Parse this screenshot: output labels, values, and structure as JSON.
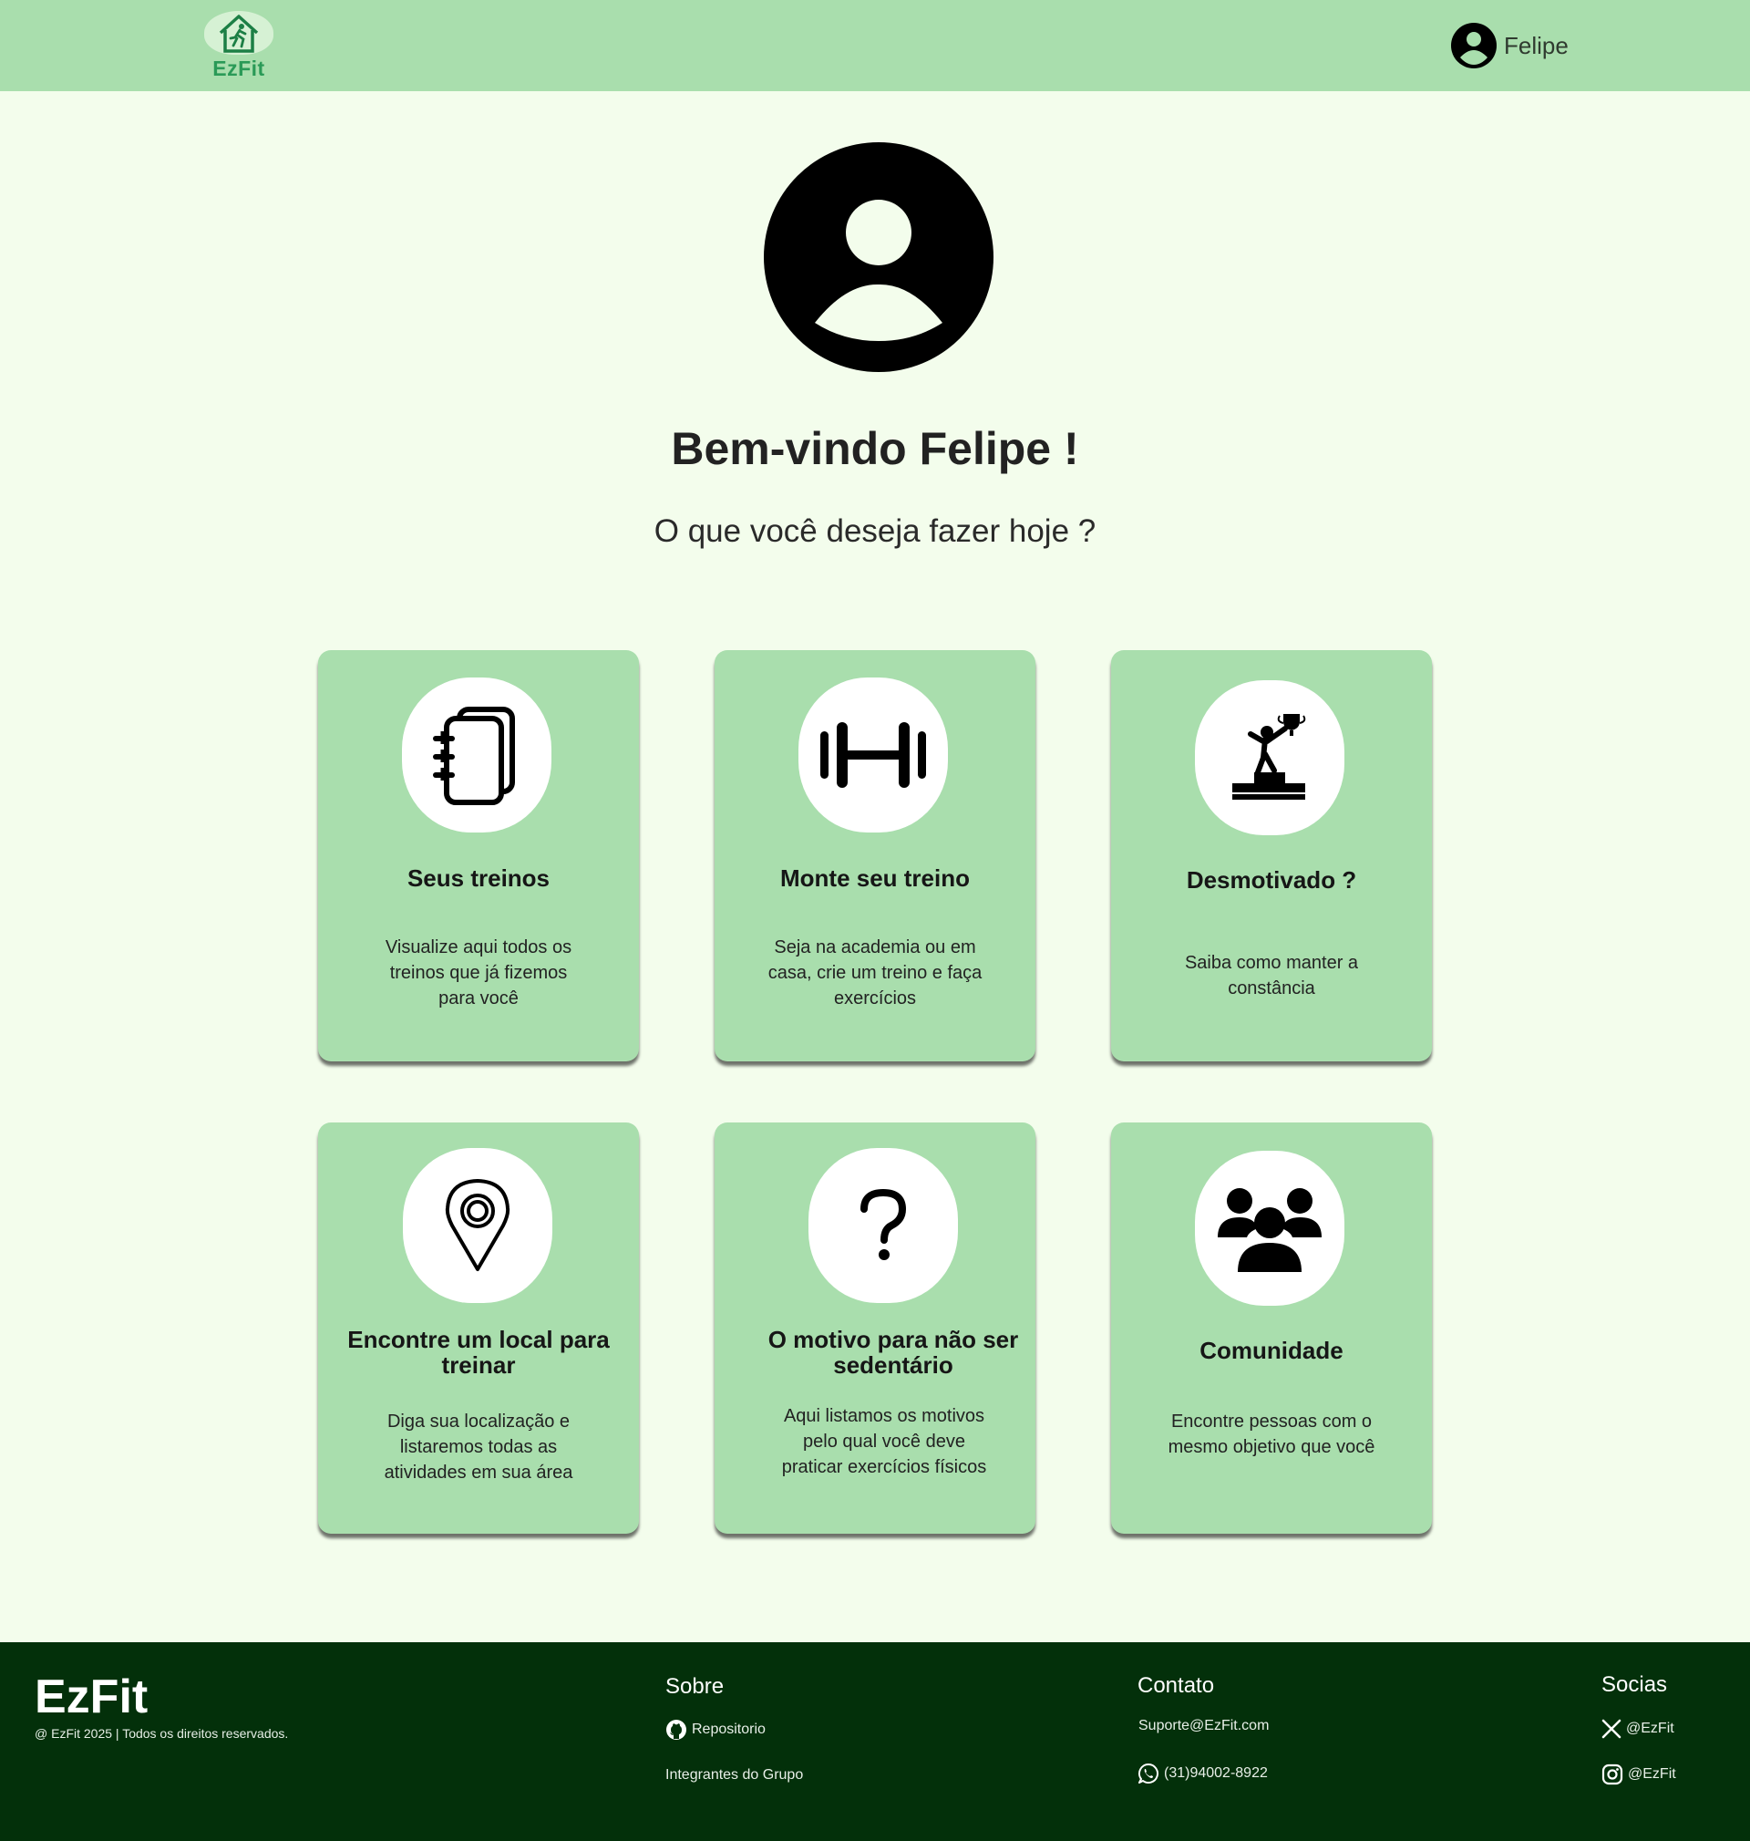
{
  "header": {
    "logo_text": "EzFit",
    "user_name": "Felipe"
  },
  "hero": {
    "welcome": "Bem-vindo Felipe !",
    "subtitle": "O que você deseja fazer hoje ?"
  },
  "cards": [
    {
      "title": "Seus treinos",
      "description": "Visualize aqui todos os treinos que já fizemos para você",
      "icon": "notebook-icon"
    },
    {
      "title": "Monte seu treino",
      "description": "Seja na academia ou em casa, crie um treino e faça exercícios",
      "icon": "dumbbell-icon"
    },
    {
      "title": "Desmotivado ?",
      "description": "Saiba como manter a constância",
      "icon": "trophy-podium-icon"
    },
    {
      "title": "Encontre um local para treinar",
      "description": "Diga sua localização e listaremos todas as atividades em sua área",
      "icon": "map-pin-icon"
    },
    {
      "title": "O motivo para não ser sedentário",
      "description": "Aqui listamos os motivos pelo qual você deve praticar exercícios físicos",
      "icon": "question-icon"
    },
    {
      "title": "Comunidade",
      "description": "Encontre pessoas com o mesmo objetivo que você",
      "icon": "group-icon"
    }
  ],
  "footer": {
    "brand": "EzFit",
    "copyright": "@ EzFit 2025 | Todos os direitos reservados.",
    "sobre": {
      "heading": "Sobre",
      "repo": "Repositorio",
      "members": "Integrantes do Grupo"
    },
    "contato": {
      "heading": "Contato",
      "email": "Suporte@EzFit.com",
      "phone": "(31)94002-8922"
    },
    "socias": {
      "heading": "Socias",
      "x": "@EzFit",
      "instagram": "@EzFit"
    }
  },
  "colors": {
    "header_bg": "#a9dead",
    "page_bg": "#f3fdec",
    "card_bg": "#a9dead",
    "footer_bg": "#03300a",
    "logo_green": "#2a9a57"
  }
}
